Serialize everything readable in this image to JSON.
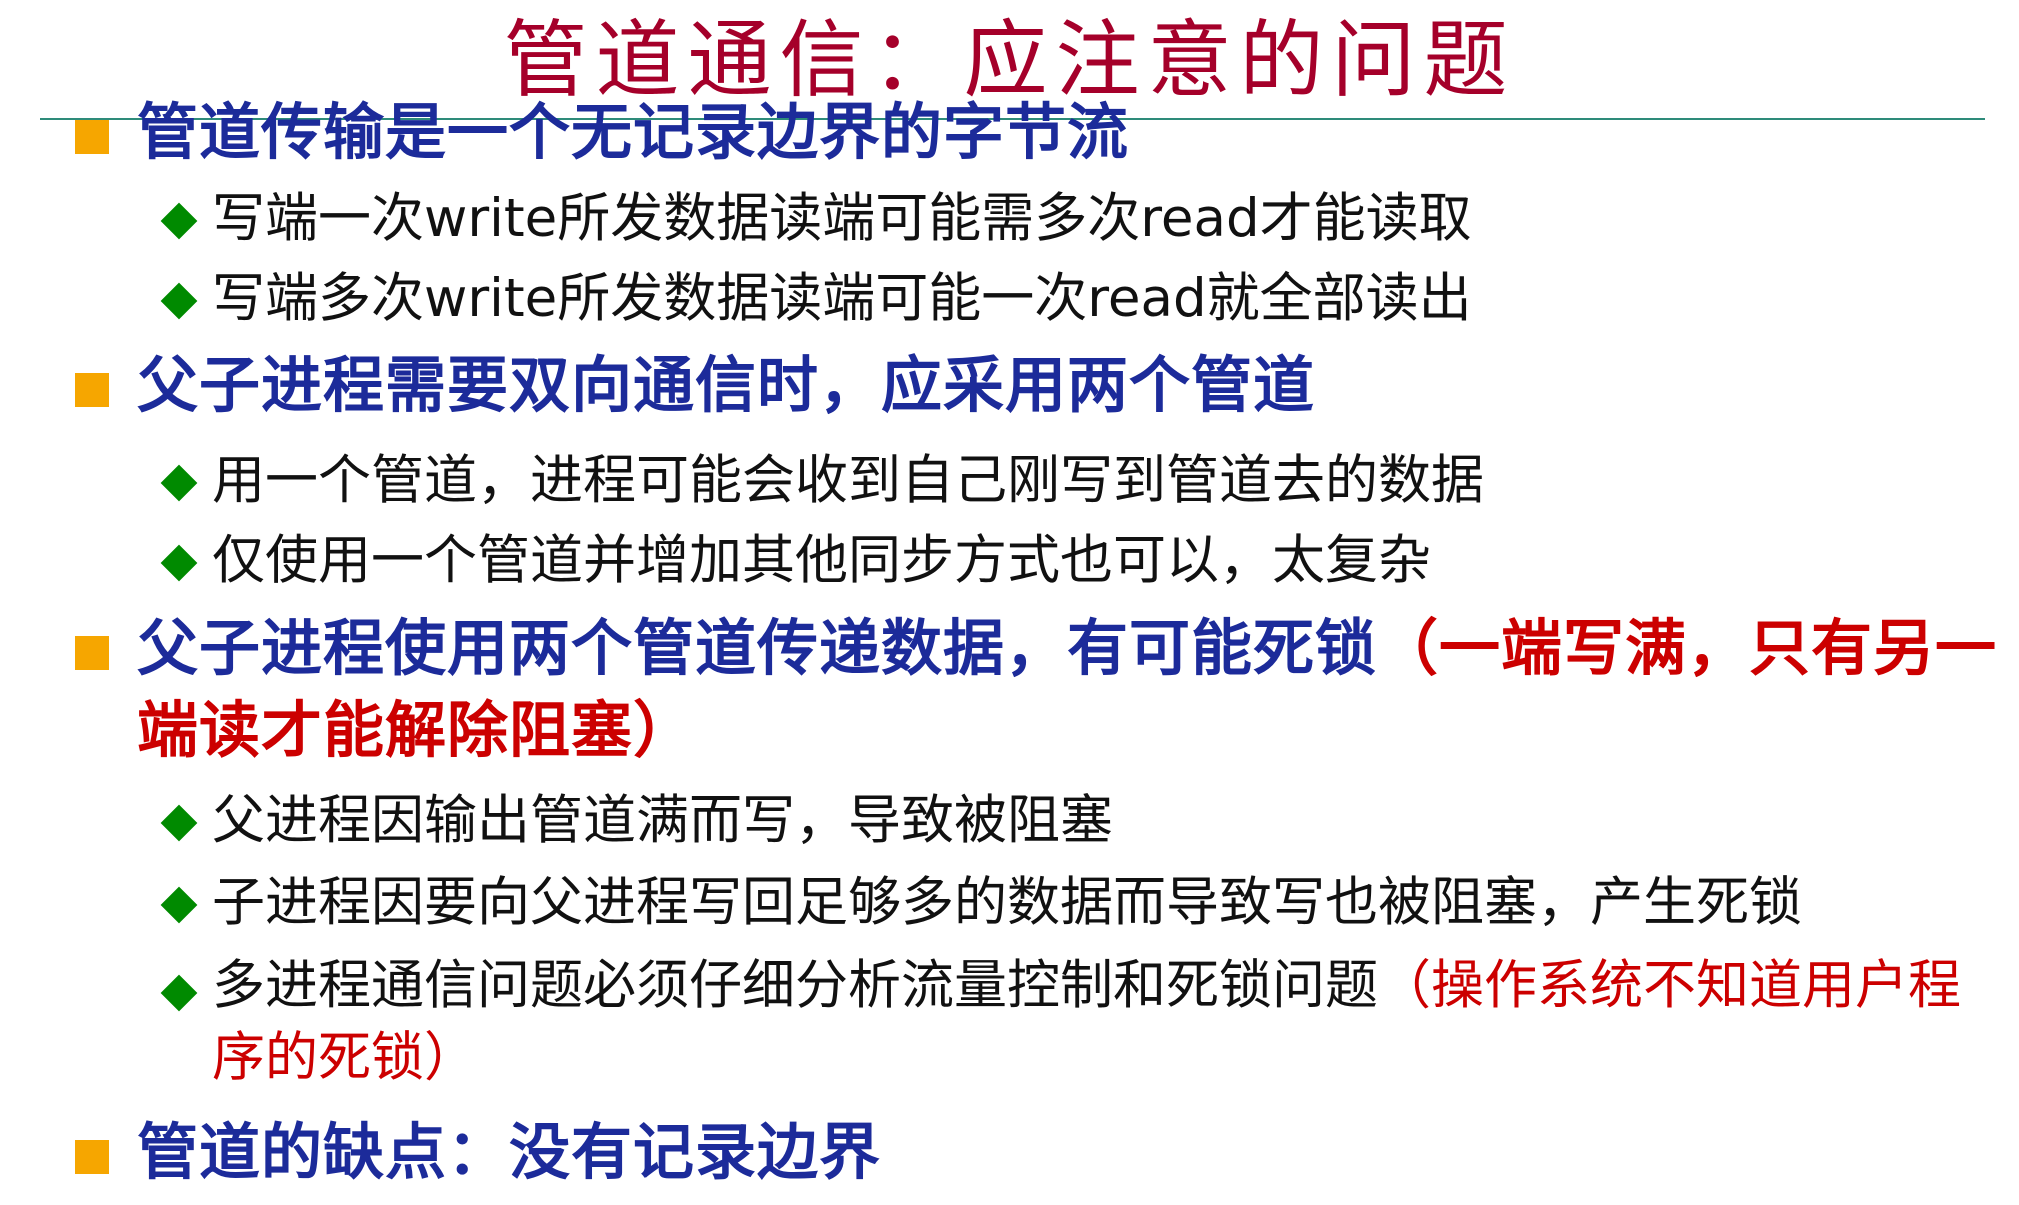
{
  "slide": {
    "title": "管道通信：应注意的问题"
  },
  "points": [
    {
      "text": "管道传输是一个无记录边界的字节流",
      "subs": [
        "写端一次write所发数据读端可能需多次read才能读取",
        "写端多次write所发数据读端可能一次read就全部读出"
      ]
    },
    {
      "text": "父子进程需要双向通信时，应采用两个管道",
      "subs": [
        "用一个管道，进程可能会收到自己刚写到管道去的数据",
        "仅使用一个管道并增加其他同步方式也可以，太复杂"
      ]
    },
    {
      "text": "父子进程使用两个管道传递数据，有可能死锁",
      "text_red": "（一端写满，只有另一端读才能解除阻塞）",
      "subs": [
        "父进程因输出管道满而写，导致被阻塞",
        "子进程因要向父进程写回足够多的数据而导致写也被阻塞，产生死锁"
      ],
      "sub_mixed": {
        "text": "多进程通信问题必须仔细分析流量控制和死锁问题",
        "text_red": "（操作系统不知道用户程序的死锁）"
      }
    },
    {
      "text": "管道的缺点：没有记录边界"
    }
  ],
  "colors": {
    "title": "#a5002a",
    "level1_text": "#1c2b9a",
    "emphasis_red": "#cc0000",
    "level1_bullet": "#f6a600",
    "level2_bullet": "#008a00",
    "title_rule": "#2e8b7a"
  },
  "icons": {
    "level1_bullet": "orange-square-bullet-icon",
    "level2_bullet": "green-diamond-bullet-icon"
  }
}
